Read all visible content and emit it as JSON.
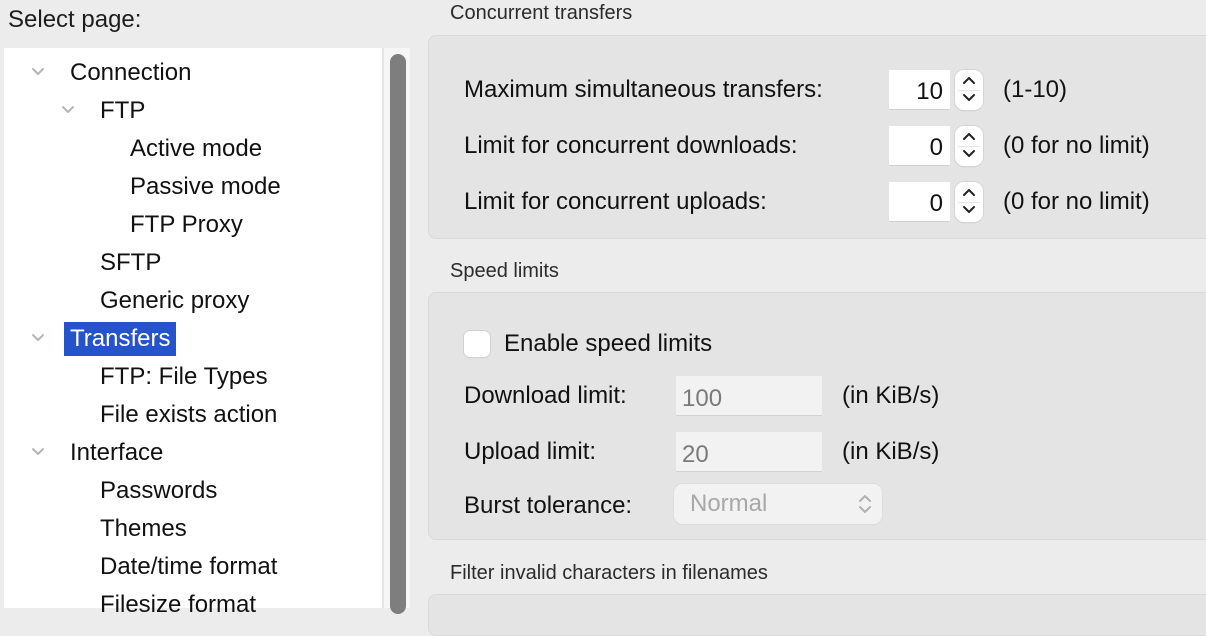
{
  "sidebar": {
    "heading": "Select page:",
    "items": [
      {
        "label": "Connection",
        "level": 0,
        "expanded": true
      },
      {
        "label": "FTP",
        "level": 1,
        "expanded": true
      },
      {
        "label": "Active mode",
        "level": 2
      },
      {
        "label": "Passive mode",
        "level": 2
      },
      {
        "label": "FTP Proxy",
        "level": 2
      },
      {
        "label": "SFTP",
        "level": 1
      },
      {
        "label": "Generic proxy",
        "level": 1
      },
      {
        "label": "Transfers",
        "level": 0,
        "expanded": true,
        "selected": true
      },
      {
        "label": "FTP: File Types",
        "level": 1
      },
      {
        "label": "File exists action",
        "level": 1
      },
      {
        "label": "Interface",
        "level": 0,
        "expanded": true
      },
      {
        "label": "Passwords",
        "level": 1
      },
      {
        "label": "Themes",
        "level": 1
      },
      {
        "label": "Date/time format",
        "level": 1
      },
      {
        "label": "Filesize format",
        "level": 1
      }
    ],
    "selected_color": "#2553cc"
  },
  "concurrent": {
    "title": "Concurrent transfers",
    "max_transfers": {
      "label": "Maximum simultaneous transfers:",
      "value": "10",
      "hint": "(1-10)"
    },
    "downloads": {
      "label": "Limit for concurrent downloads:",
      "value": "0",
      "hint": "(0 for no limit)"
    },
    "uploads": {
      "label": "Limit for concurrent uploads:",
      "value": "0",
      "hint": "(0 for no limit)"
    }
  },
  "speed": {
    "title": "Speed limits",
    "enable_label": "Enable speed limits",
    "enabled": false,
    "download": {
      "label": "Download limit:",
      "value": "100",
      "unit": "(in KiB/s)"
    },
    "upload": {
      "label": "Upload limit:",
      "value": "20",
      "unit": "(in KiB/s)"
    },
    "burst": {
      "label": "Burst tolerance:",
      "value": "Normal"
    }
  },
  "filter": {
    "title": "Filter invalid characters in filenames"
  }
}
